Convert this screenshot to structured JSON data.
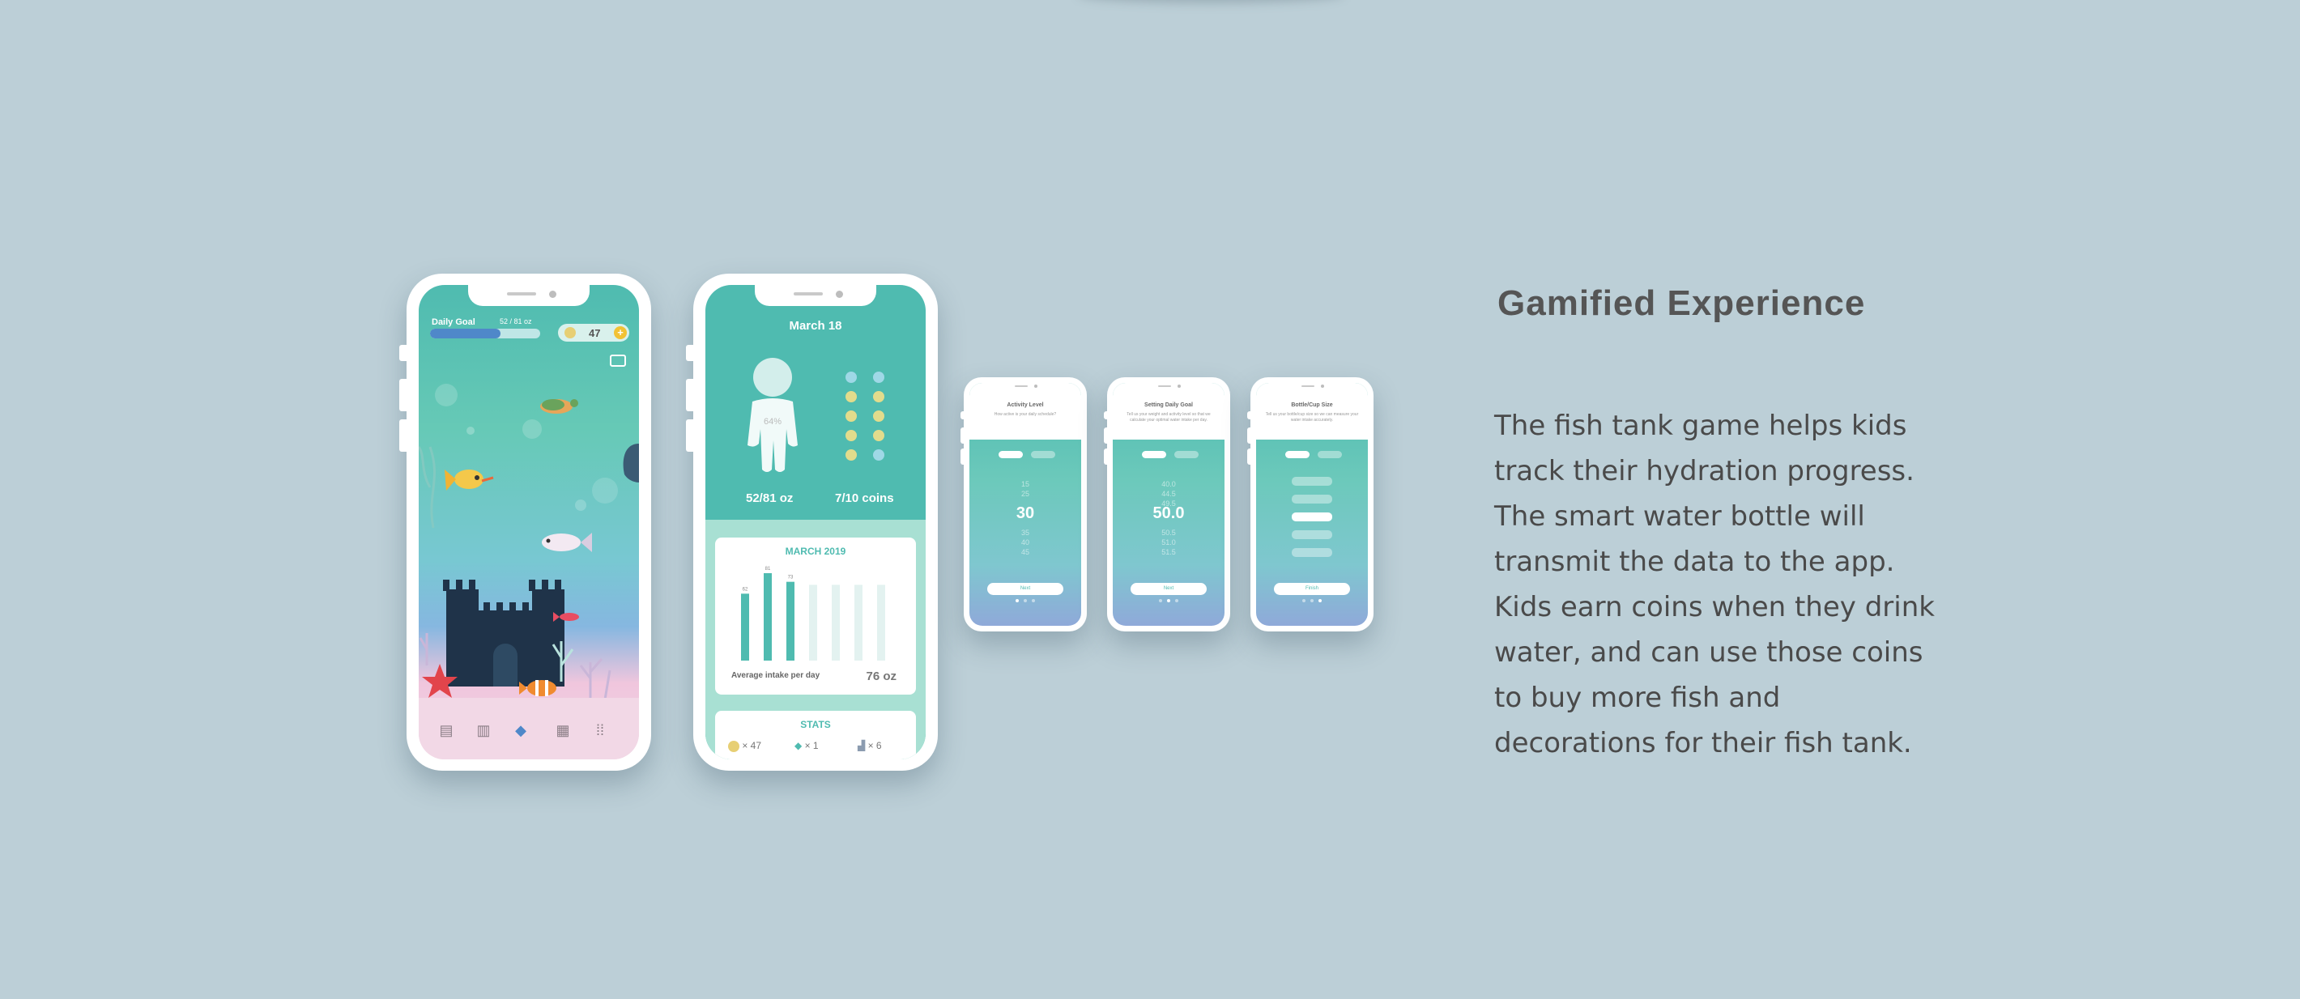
{
  "text": {
    "heading": "Gamified Experience",
    "paragraph": "The fish tank game helps kids track their hydration progress. The smart water bottle will transmit the data to the app. Kids earn coins when they drink water, and can use those coins to buy more fish and decorations for their fish tank."
  },
  "phone_fish_tank": {
    "daily_goal_label": "Daily Goal",
    "oz_progress": "52 / 81 oz",
    "progress_fraction": 0.64,
    "coins": "47",
    "plus": "+",
    "nav_icons": [
      "shop-icon",
      "chart-icon",
      "fish-icon",
      "calculator-icon",
      "grid-icon"
    ]
  },
  "phone_stats": {
    "date": "March 18",
    "body_percent": "64%",
    "oz": "52/81 oz",
    "coins": "7/10 coins",
    "coins_earned": 7,
    "coins_total": 10,
    "chart_title": "MARCH 2019",
    "avg_label": "Average intake per day",
    "avg_value": "76 oz",
    "stats_title": "STATS",
    "stat_coins": "× 47",
    "stat_fish": "× 1",
    "stat_deco": "× 6"
  },
  "chart_data": {
    "type": "bar",
    "values": [
      62,
      81,
      73,
      null,
      null,
      null,
      null
    ],
    "series_labels": [
      "62",
      "81",
      "73"
    ],
    "ylim": [
      0,
      90
    ],
    "colors": {
      "filled": "#4fbbb0",
      "empty": "#e3f2f0"
    }
  },
  "onboarding": [
    {
      "title": "Activity Level",
      "subtitle": "How active is your daily schedule?",
      "toggles": 2,
      "wheel_above": [
        "15",
        "25"
      ],
      "selected": "30",
      "wheel_below": [
        "35",
        "40",
        "45"
      ],
      "button": "Next",
      "page": 0
    },
    {
      "title": "Setting Daily Goal",
      "subtitle": "Tell us your weight and activity level so that we calculate your optimal water intake per day.",
      "toggles": 2,
      "wheel_above": [
        "40.0",
        "44.5",
        "49.5"
      ],
      "selected": "50.0",
      "wheel_below": [
        "50.5",
        "51.0",
        "51.5"
      ],
      "button": "Next",
      "page": 1
    },
    {
      "title": "Bottle/Cup Size",
      "subtitle": "Tell us your bottle/cup size so we can measure your water intake accurately.",
      "toggles": 2,
      "wheel_above": [],
      "selected": "",
      "wheel_below": [],
      "button": "Finish",
      "page": 2
    }
  ]
}
